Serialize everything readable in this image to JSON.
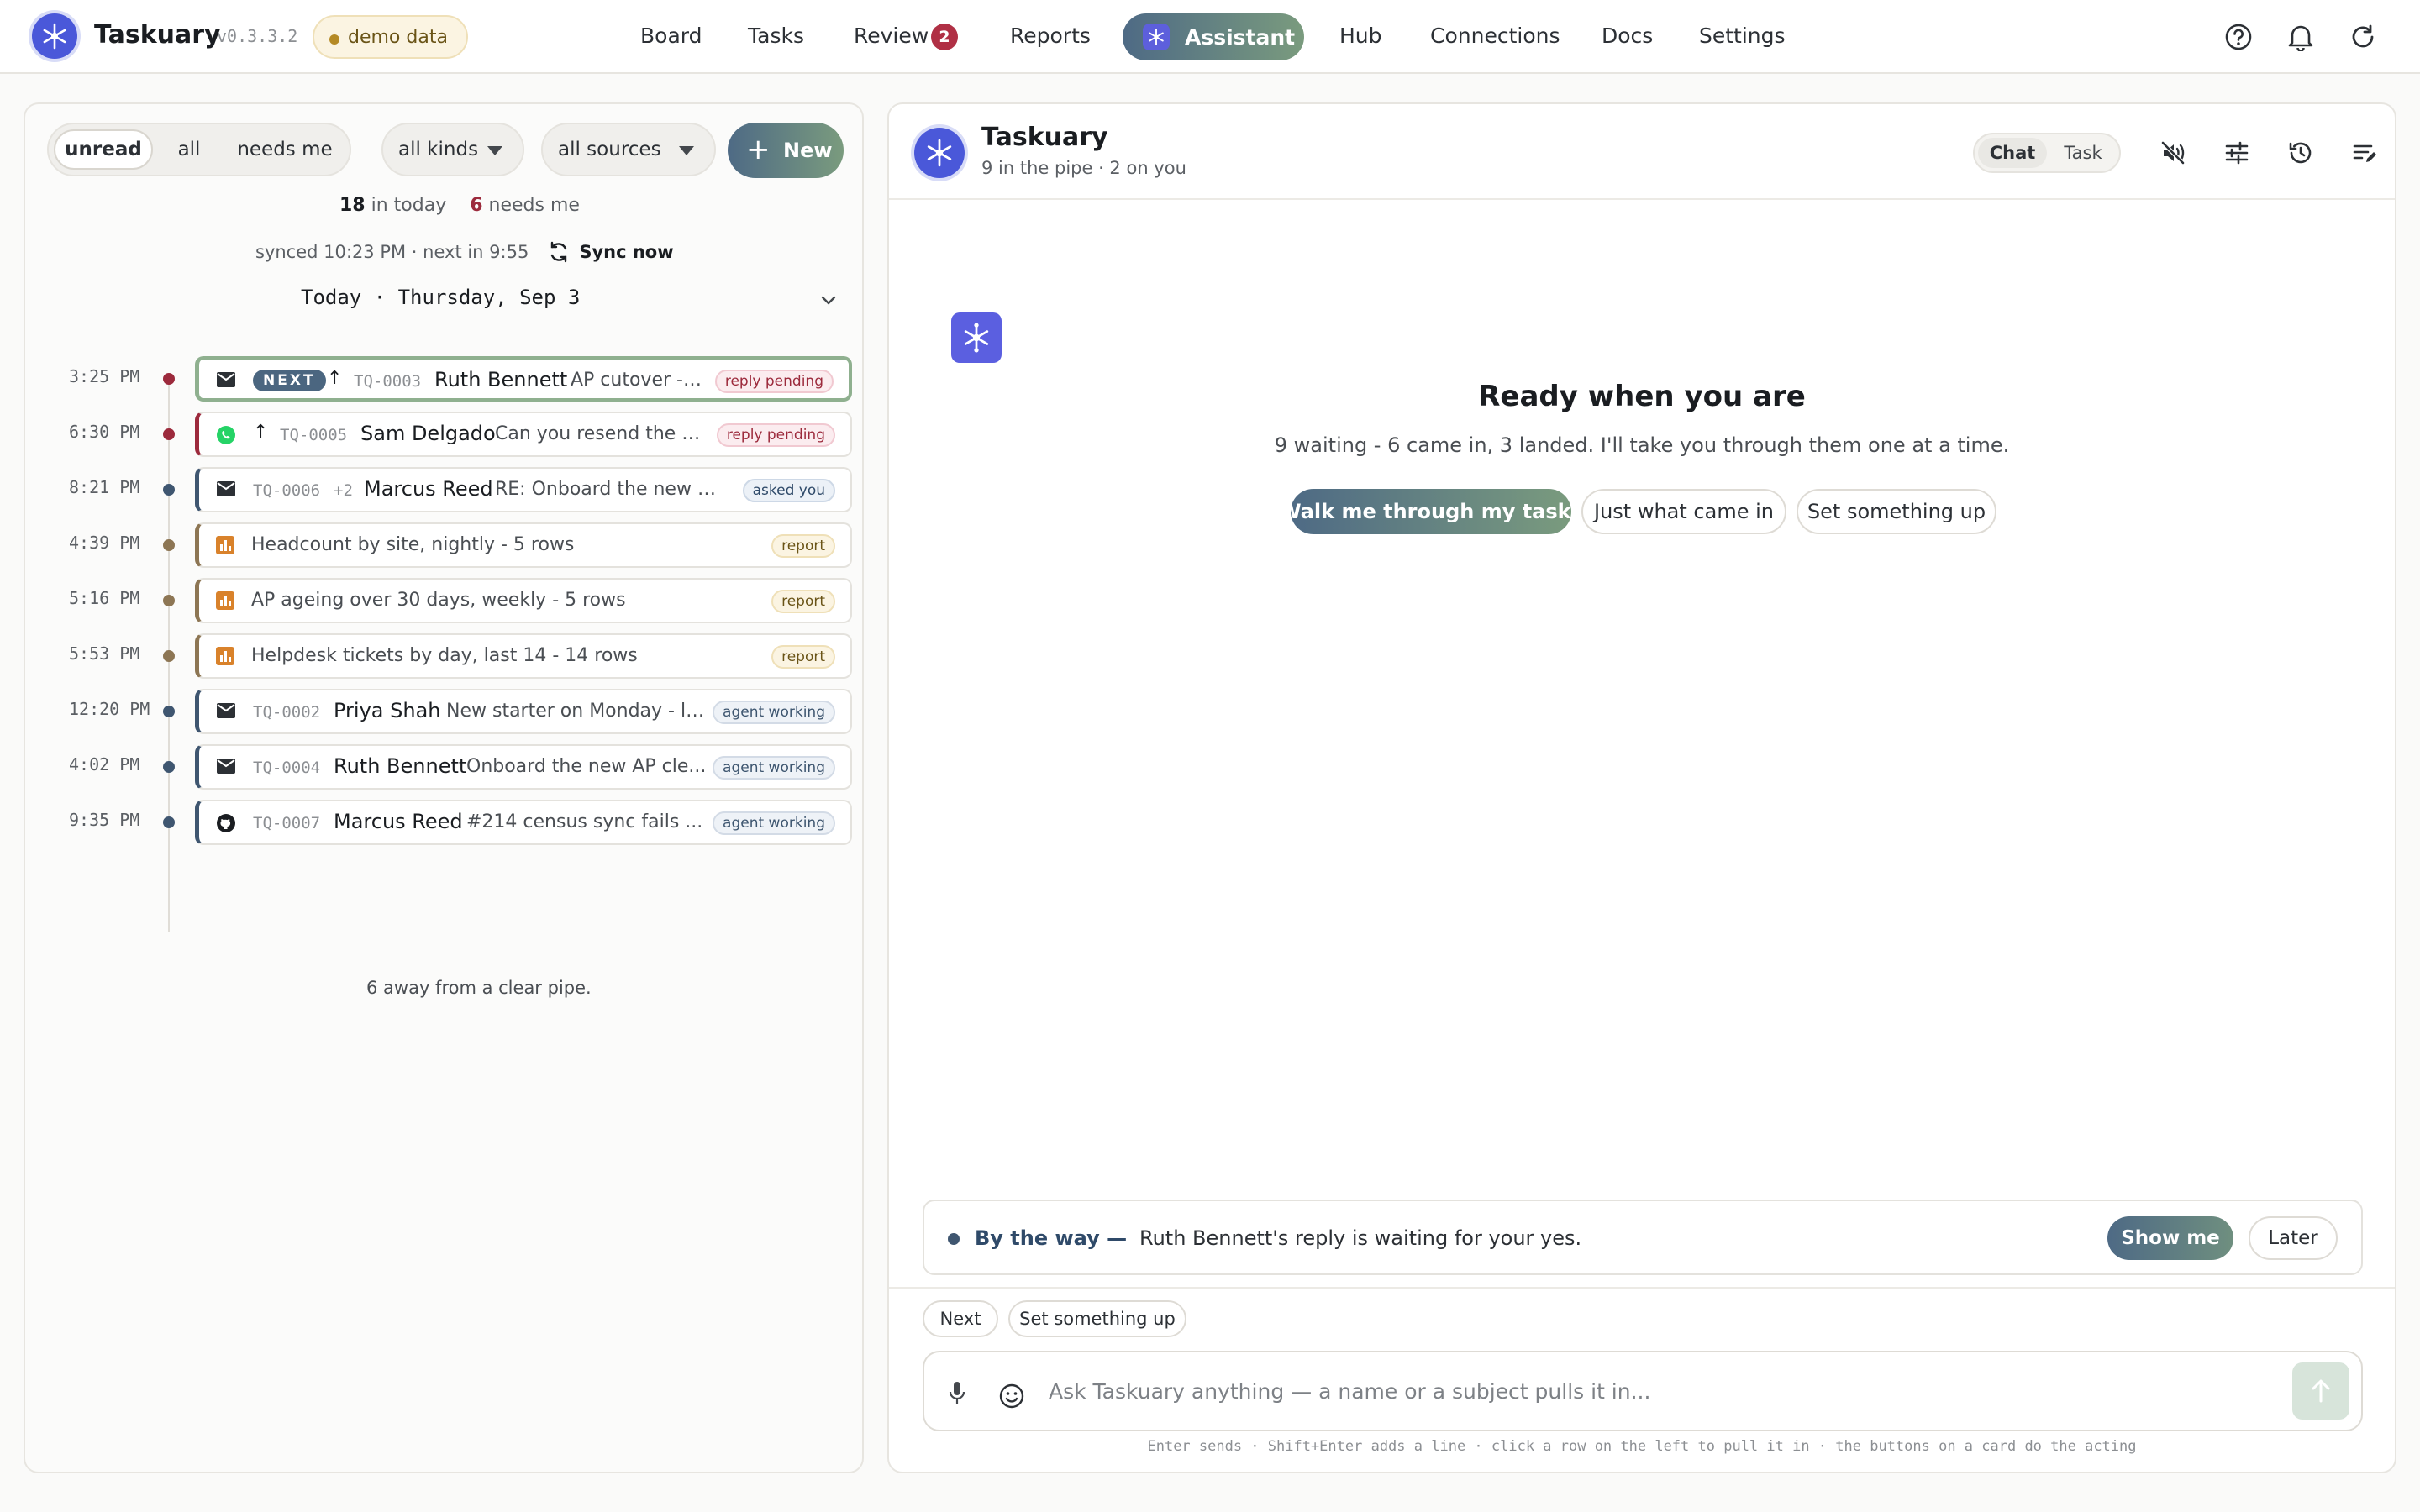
{
  "app": {
    "name": "Taskuary",
    "version": "v0.3.3.2",
    "demo_label": "demo data",
    "colors": {
      "brand": "#4a58d9",
      "accent_gradient_start": "#4e6a85",
      "accent_gradient_end": "#7a9b7e",
      "danger": "#9c2a3c"
    }
  },
  "nav": {
    "items": [
      {
        "label": "Board"
      },
      {
        "label": "Tasks"
      },
      {
        "label": "Review",
        "badge": "2"
      },
      {
        "label": "Reports"
      },
      {
        "label": "Assistant",
        "active": true
      },
      {
        "label": "Hub"
      },
      {
        "label": "Connections"
      },
      {
        "label": "Docs"
      },
      {
        "label": "Settings"
      }
    ],
    "icons": [
      "help-icon",
      "bell-icon",
      "refresh-icon"
    ]
  },
  "inbox": {
    "filters": {
      "unread": "unread",
      "all": "all",
      "needs_me": "needs me",
      "active": "unread"
    },
    "kinds": "all kinds",
    "sources": "all sources",
    "new_label": "New",
    "stats": {
      "in_today": "18",
      "in_today_label": "in today",
      "needs_me": "6",
      "needs_me_label": "needs me"
    },
    "sync": {
      "text": "synced 10:23 PM · next in 9:55",
      "button": "Sync now"
    },
    "date": "Today · Thursday, Sep 3",
    "rows": [
      {
        "time": "3:25 PM",
        "icon": "mail-icon",
        "next": "NEXT",
        "arrow": "↑",
        "id": "TQ-0003",
        "name": "Ruth Bennett",
        "subject": "AP cutover - ...",
        "tag": "reply pending",
        "tag_kind": "reply",
        "dot": "#9c2a3c"
      },
      {
        "time": "6:30 PM",
        "icon": "whatsapp-icon",
        "arrow": "↑",
        "id": "TQ-0005",
        "name": "Sam Delgado",
        "subject": "Can you resend the Q...",
        "tag": "reply pending",
        "tag_kind": "reply",
        "dot": "#9c2a3c"
      },
      {
        "time": "8:21 PM",
        "icon": "mail-icon",
        "id": "TQ-0006",
        "extra": "+2",
        "name": "Marcus Reed",
        "subject": "RE: Onboard the new AP...",
        "tag": "asked you",
        "tag_kind": "asked",
        "dot": "#3f5670"
      },
      {
        "time": "4:39 PM",
        "icon": "chart-icon",
        "title": "Headcount by site, nightly - 5 rows",
        "tag": "report",
        "tag_kind": "report",
        "dot": "#8d7654"
      },
      {
        "time": "5:16 PM",
        "icon": "chart-icon",
        "title": "AP ageing over 30 days, weekly - 5 rows",
        "tag": "report",
        "tag_kind": "report",
        "dot": "#8d7654"
      },
      {
        "time": "5:53 PM",
        "icon": "chart-icon",
        "title": "Helpdesk tickets by day, last 14 - 14 rows",
        "tag": "report",
        "tag_kind": "report",
        "dot": "#8d7654"
      },
      {
        "time": "12:20 PM",
        "icon": "mail-icon",
        "id": "TQ-0002",
        "name": "Priya Shah",
        "subject": "New starter on Monday - la...",
        "tag": "agent working",
        "tag_kind": "agent",
        "dot": "#3f5670"
      },
      {
        "time": "4:02 PM",
        "icon": "mail-icon",
        "id": "TQ-0004",
        "name": "Ruth Bennett",
        "subject": "Onboard the new AP cle...",
        "tag": "agent working",
        "tag_kind": "agent",
        "dot": "#3f5670"
      },
      {
        "time": "9:35 PM",
        "icon": "github-icon",
        "id": "TQ-0007",
        "name": "Marcus Reed",
        "subject": "#214 census sync fails ...",
        "tag": "agent working",
        "tag_kind": "agent",
        "dot": "#3f5670"
      }
    ],
    "footer": "6 away from a clear pipe."
  },
  "assistant": {
    "title": "Taskuary",
    "subtitle": "9 in the pipe · 2 on you",
    "modes": {
      "chat": "Chat",
      "task": "Task",
      "active": "Chat"
    },
    "header_icons": [
      "mute-icon",
      "sliders-icon",
      "history-icon",
      "edit-list-icon"
    ],
    "ready_title": "Ready when you are",
    "ready_sub": "9 waiting - 6 came in, 3 landed. I'll take you through them one at a time.",
    "ctas": {
      "walk": "Walk me through my tasks",
      "came_in": "Just what came in",
      "setup": "Set something up"
    },
    "btw": {
      "lead": "By the way —",
      "message": "Ruth Bennett's reply is waiting for your yes.",
      "show": "Show me",
      "later": "Later"
    },
    "chips": {
      "next": "Next",
      "setup": "Set something up"
    },
    "composer": {
      "placeholder": "Ask Taskuary anything — a name or a subject pulls it in...",
      "value": ""
    },
    "hint": "Enter sends · Shift+Enter adds a line · click a row on the left to pull it in · the buttons on a card do the acting"
  }
}
